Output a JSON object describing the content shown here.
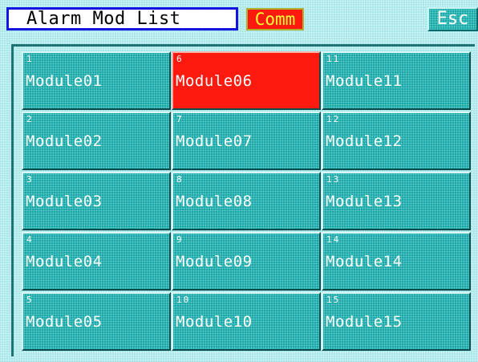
{
  "header": {
    "title": "Alarm Mod List",
    "comm_label": "Comm",
    "esc_label": "Esc"
  },
  "colors": {
    "background": "#a9e6e9",
    "module_button": "#1ea5a5",
    "active_module": "#ff1a10",
    "title_border": "#1414e0",
    "comm_text": "#ffff30"
  },
  "modules": [
    {
      "number": "1",
      "name": "Module01",
      "active": false
    },
    {
      "number": "6",
      "name": "Module06",
      "active": true
    },
    {
      "number": "11",
      "name": "Module11",
      "active": false
    },
    {
      "number": "2",
      "name": "Module02",
      "active": false
    },
    {
      "number": "7",
      "name": "Module07",
      "active": false
    },
    {
      "number": "12",
      "name": "Module12",
      "active": false
    },
    {
      "number": "3",
      "name": "Module03",
      "active": false
    },
    {
      "number": "8",
      "name": "Module08",
      "active": false
    },
    {
      "number": "13",
      "name": "Module13",
      "active": false
    },
    {
      "number": "4",
      "name": "Module04",
      "active": false
    },
    {
      "number": "9",
      "name": "Module09",
      "active": false
    },
    {
      "number": "14",
      "name": "Module14",
      "active": false
    },
    {
      "number": "5",
      "name": "Module05",
      "active": false
    },
    {
      "number": "10",
      "name": "Module10",
      "active": false
    },
    {
      "number": "15",
      "name": "Module15",
      "active": false
    }
  ]
}
